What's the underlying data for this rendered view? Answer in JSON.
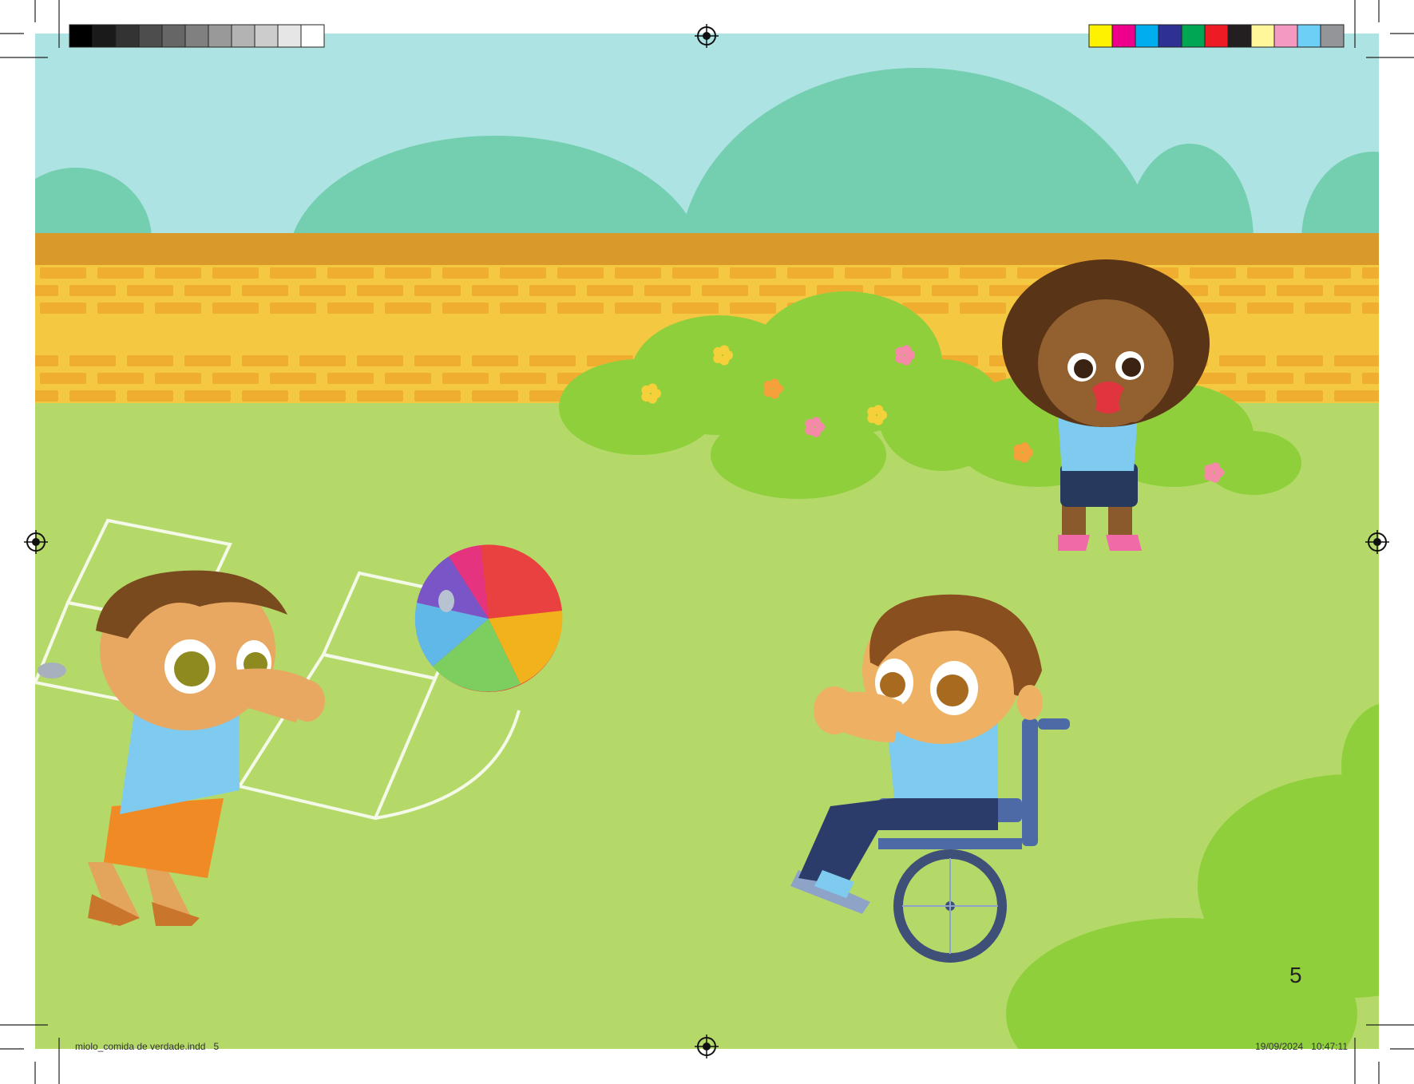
{
  "page": {
    "number": "5",
    "slug_file": "miolo_comida de verdade.indd   5",
    "slug_timestamp": "19/09/2024   10:47:11"
  },
  "print_marks": {
    "gray_swatches": [
      "#000000",
      "#1a1a1a",
      "#333333",
      "#4d4d4d",
      "#666666",
      "#808080",
      "#999999",
      "#b3b3b3",
      "#cccccc",
      "#e6e6e6",
      "#ffffff"
    ],
    "color_swatches": [
      "#fff200",
      "#ec008c",
      "#00aeef",
      "#2e3192",
      "#00a651",
      "#ed1c24",
      "#231f20",
      "#fff799",
      "#f49ac1",
      "#6dcff6",
      "#939598"
    ]
  },
  "palette": {
    "sky": "#aee3e3",
    "hills": "#74cfb0",
    "wall_top": "#d99a2b",
    "brick": "#f5c842",
    "brick_dark": "#efa92e",
    "grass": "#b5d968",
    "bush": "#8fcf3c",
    "shirt": "#7ecbef"
  },
  "illustration": {
    "ball_colors": [
      "#e94040",
      "#f2b21b",
      "#7ccf5f",
      "#5fb8e8",
      "#7a55c8",
      "#e6337f"
    ]
  }
}
